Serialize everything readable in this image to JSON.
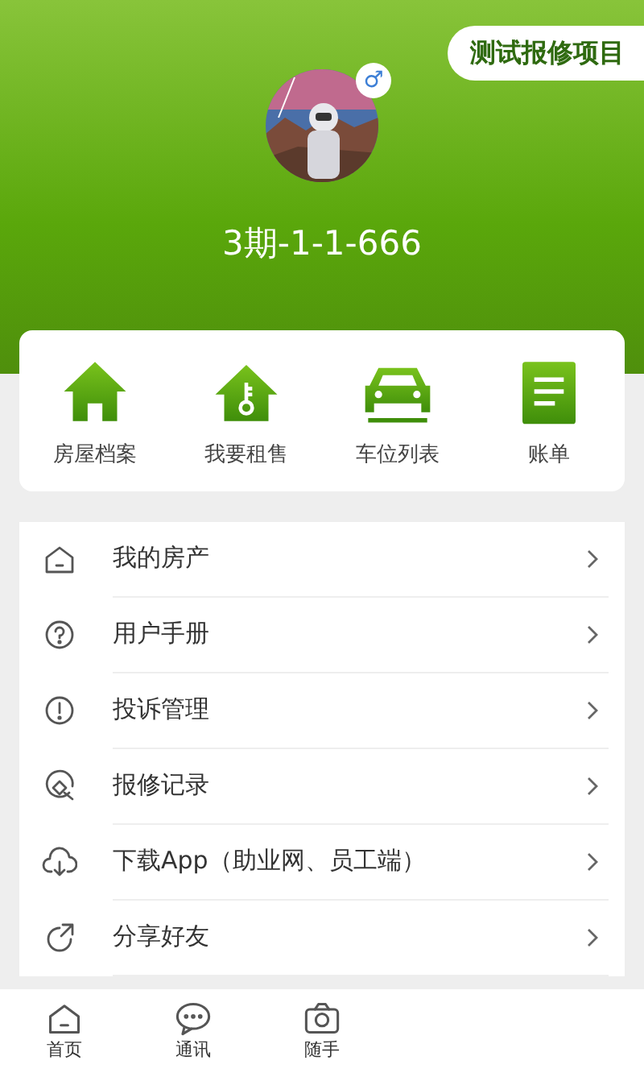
{
  "header": {
    "project_button": "测试报修项目",
    "gender": "♂",
    "room": "3期-1-1-666"
  },
  "shortcuts": [
    {
      "label": "房屋档案",
      "kind": "house"
    },
    {
      "label": "我要租售",
      "kind": "key"
    },
    {
      "label": "车位列表",
      "kind": "car"
    },
    {
      "label": "账单",
      "kind": "bill"
    }
  ],
  "menu": [
    {
      "label": "我的房产",
      "kind": "home"
    },
    {
      "label": "用户手册",
      "kind": "help"
    },
    {
      "label": "投诉管理",
      "kind": "alert"
    },
    {
      "label": "报修记录",
      "kind": "repair"
    },
    {
      "label": "下载App（助业网、员工端）",
      "kind": "download"
    },
    {
      "label": "分享好友",
      "kind": "share"
    }
  ],
  "tab_bar": [
    {
      "label": "首页",
      "kind": "home"
    },
    {
      "label": "通讯",
      "kind": "chat"
    },
    {
      "label": "随手",
      "kind": "camera"
    }
  ]
}
